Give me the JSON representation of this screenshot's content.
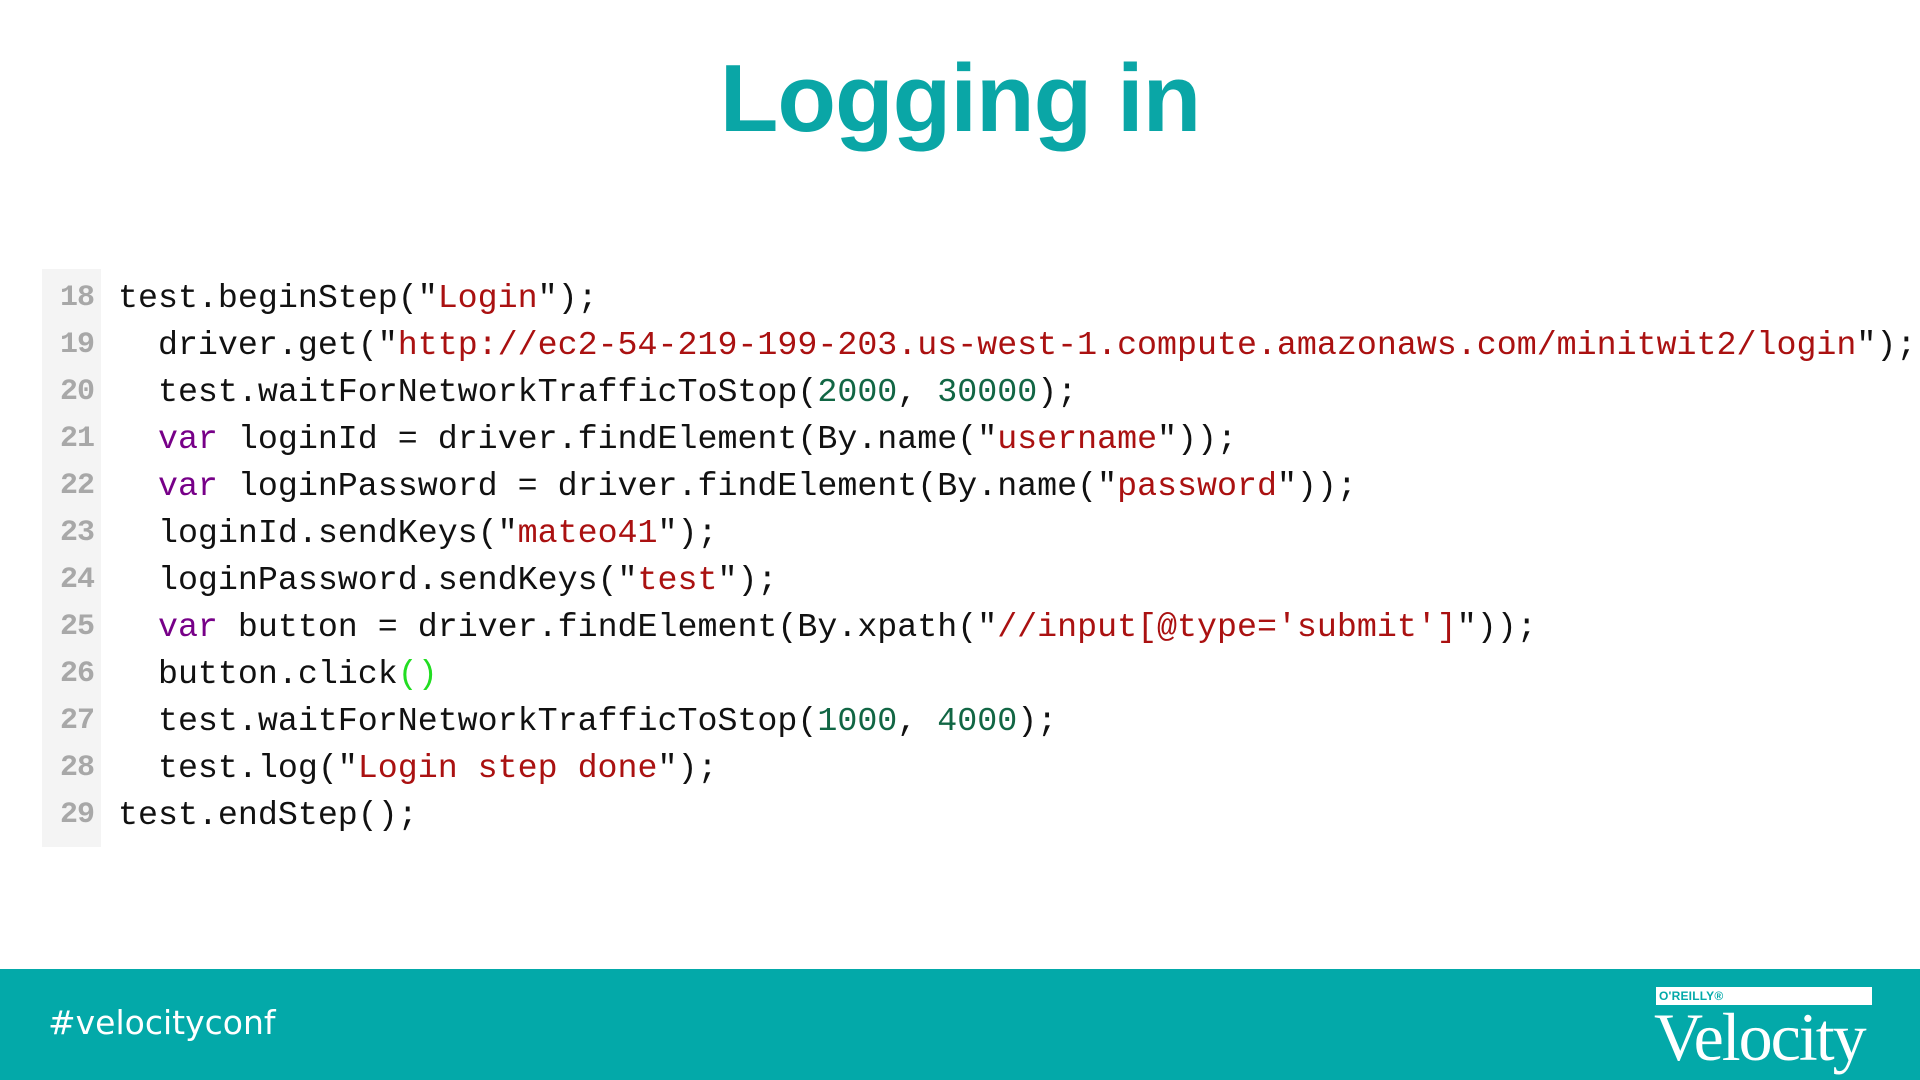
{
  "slide": {
    "title": "Logging in"
  },
  "colors": {
    "accent": "#0aa6a6",
    "footer_bg": "#03a9a9",
    "keyword": "#770088",
    "string": "#aa1111",
    "number": "#116644",
    "matched_bracket": "#22dd22",
    "gutter_bg": "#f4f4f4",
    "line_number": "#a8a8a8"
  },
  "code": {
    "lines": [
      {
        "number": "18",
        "tokens": [
          {
            "t": "plain",
            "v": "test.beginStep(\""
          },
          {
            "t": "str",
            "v": "Login"
          },
          {
            "t": "plain",
            "v": "\");"
          }
        ]
      },
      {
        "number": "19",
        "tokens": [
          {
            "t": "plain",
            "v": "  driver.get(\""
          },
          {
            "t": "str",
            "v": "http://ec2-54-219-199-203.us-west-1.compute.amazonaws.com/minitwit2/login"
          },
          {
            "t": "plain",
            "v": "\");"
          }
        ]
      },
      {
        "number": "20",
        "tokens": [
          {
            "t": "plain",
            "v": "  test.waitForNetworkTrafficToStop("
          },
          {
            "t": "num",
            "v": "2000"
          },
          {
            "t": "plain",
            "v": ", "
          },
          {
            "t": "num",
            "v": "30000"
          },
          {
            "t": "plain",
            "v": ");"
          }
        ]
      },
      {
        "number": "21",
        "tokens": [
          {
            "t": "plain",
            "v": "  "
          },
          {
            "t": "kw",
            "v": "var"
          },
          {
            "t": "plain",
            "v": " loginId = driver.findElement(By.name(\""
          },
          {
            "t": "str",
            "v": "username"
          },
          {
            "t": "plain",
            "v": "\"));"
          }
        ]
      },
      {
        "number": "22",
        "tokens": [
          {
            "t": "plain",
            "v": "  "
          },
          {
            "t": "kw",
            "v": "var"
          },
          {
            "t": "plain",
            "v": " loginPassword = driver.findElement(By.name(\""
          },
          {
            "t": "str",
            "v": "password"
          },
          {
            "t": "plain",
            "v": "\"));"
          }
        ]
      },
      {
        "number": "23",
        "tokens": [
          {
            "t": "plain",
            "v": "  loginId.sendKeys(\""
          },
          {
            "t": "str",
            "v": "mateo41"
          },
          {
            "t": "plain",
            "v": "\");"
          }
        ]
      },
      {
        "number": "24",
        "tokens": [
          {
            "t": "plain",
            "v": "  loginPassword.sendKeys(\""
          },
          {
            "t": "str",
            "v": "test"
          },
          {
            "t": "plain",
            "v": "\");"
          }
        ]
      },
      {
        "number": "25",
        "tokens": [
          {
            "t": "plain",
            "v": "  "
          },
          {
            "t": "kw",
            "v": "var"
          },
          {
            "t": "plain",
            "v": " button = driver.findElement(By.xpath(\""
          },
          {
            "t": "str",
            "v": "//input[@type='submit']"
          },
          {
            "t": "plain",
            "v": "\"));"
          }
        ]
      },
      {
        "number": "26",
        "tokens": [
          {
            "t": "plain",
            "v": "  button.click"
          },
          {
            "t": "bracket",
            "v": "()"
          }
        ]
      },
      {
        "number": "27",
        "tokens": [
          {
            "t": "plain",
            "v": "  test.waitForNetworkTrafficToStop("
          },
          {
            "t": "num",
            "v": "1000"
          },
          {
            "t": "plain",
            "v": ", "
          },
          {
            "t": "num",
            "v": "4000"
          },
          {
            "t": "plain",
            "v": ");"
          }
        ]
      },
      {
        "number": "28",
        "tokens": [
          {
            "t": "plain",
            "v": "  test.log(\""
          },
          {
            "t": "str",
            "v": "Login step done"
          },
          {
            "t": "plain",
            "v": "\");"
          }
        ]
      },
      {
        "number": "29",
        "tokens": [
          {
            "t": "plain",
            "v": "test.endStep();"
          }
        ]
      }
    ]
  },
  "footer": {
    "hashtag": "#velocityconf",
    "logo": {
      "publisher": "O'REILLY®",
      "wordmark": "Velocity"
    }
  }
}
